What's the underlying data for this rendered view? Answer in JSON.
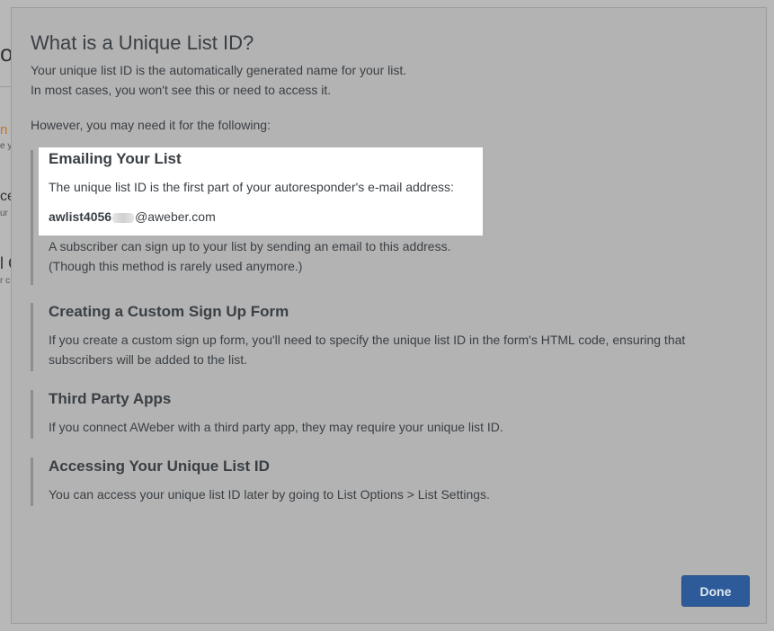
{
  "background": {
    "fragments": [
      "o",
      "n",
      "e y",
      "ce",
      "ur",
      "l C",
      "r c"
    ]
  },
  "modal": {
    "title": "What is a Unique List ID?",
    "intro_line1": "Your unique list ID is the automatically generated name for your list.",
    "intro_line2": "In most cases, you won't see this or need to access it.",
    "followup": "However, you may need it for the following:",
    "sections": [
      {
        "heading": "Emailing Your List",
        "text": "The unique list ID is the first part of your autoresponder's e-mail address:",
        "address_prefix": "awlist4056",
        "address_suffix": "@aweber.com",
        "text2_line1": "A subscriber can sign up to your list by sending an email to this address.",
        "text2_line2": "(Though this method is rarely used anymore.)"
      },
      {
        "heading": "Creating a Custom Sign Up Form",
        "text": "If you create a custom sign up form, you'll need to specify the unique list ID in the form's HTML code, ensuring that subscribers will be added to the list."
      },
      {
        "heading": "Third Party Apps",
        "text": "If you connect AWeber with a third party app, they may require your unique list ID."
      },
      {
        "heading": "Accessing Your Unique List ID",
        "text": "You can access your unique list ID later by going to List Options > List Settings."
      }
    ],
    "done_label": "Done"
  },
  "colors": {
    "overlay": "#7a7a7a",
    "modal_bg": "#b3b3b3",
    "highlight": "#ffffff",
    "primary_button": "#2d5b9a",
    "text": "#3a3f44",
    "section_rule": "#8e8e8e"
  }
}
